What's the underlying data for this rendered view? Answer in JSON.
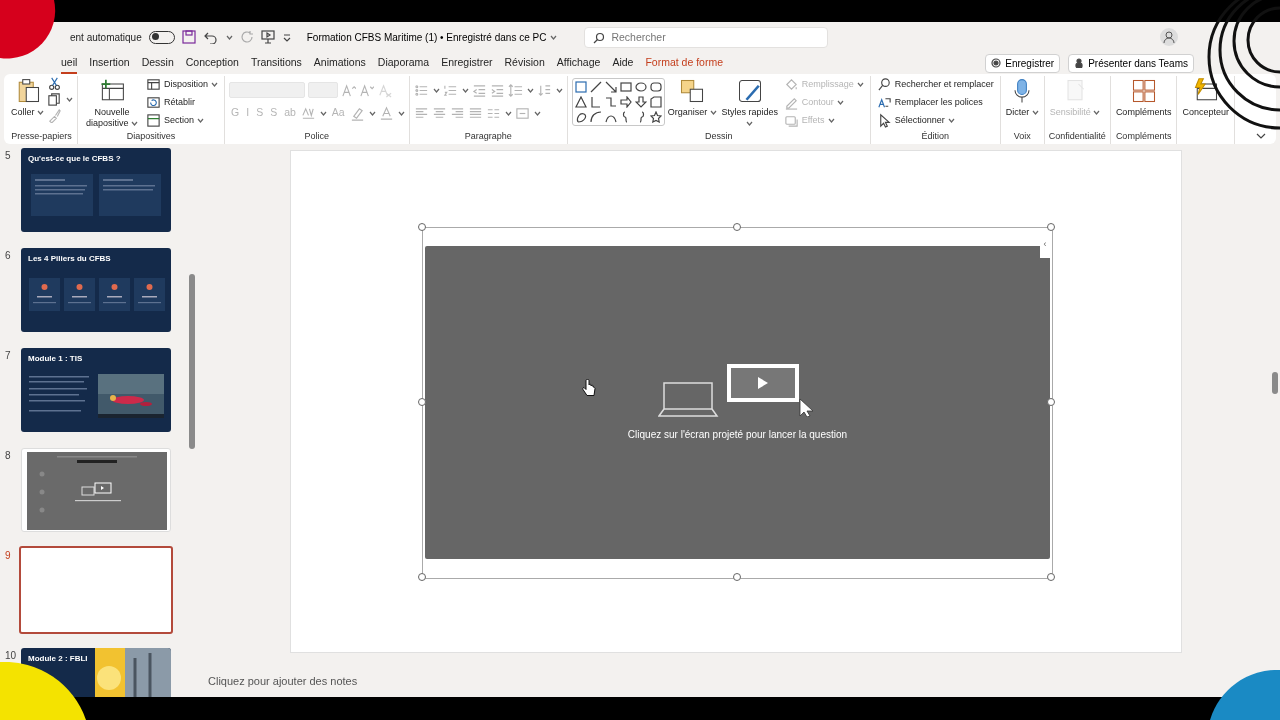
{
  "title_bar": {
    "autosave": {
      "label": "ent automatique",
      "on": false
    },
    "document_title": "Formation CFBS Maritime (1) • Enregistré dans ce PC",
    "search": {
      "placeholder": "Rechercher"
    }
  },
  "ribbon_tabs": [
    {
      "label": "ueil",
      "selected": true,
      "kind": "normal"
    },
    {
      "label": "Insertion",
      "selected": false,
      "kind": "normal"
    },
    {
      "label": "Dessin",
      "selected": false,
      "kind": "normal"
    },
    {
      "label": "Conception",
      "selected": false,
      "kind": "normal"
    },
    {
      "label": "Transitions",
      "selected": false,
      "kind": "normal"
    },
    {
      "label": "Animations",
      "selected": false,
      "kind": "normal"
    },
    {
      "label": "Diaporama",
      "selected": false,
      "kind": "normal"
    },
    {
      "label": "Enregistrer",
      "selected": false,
      "kind": "normal"
    },
    {
      "label": "Révision",
      "selected": false,
      "kind": "normal"
    },
    {
      "label": "Affichage",
      "selected": false,
      "kind": "normal"
    },
    {
      "label": "Aide",
      "selected": false,
      "kind": "normal"
    },
    {
      "label": "Format de forme",
      "selected": false,
      "kind": "contextual"
    }
  ],
  "ribbon_actions": [
    {
      "label": "Enregistrer"
    },
    {
      "label": "Présenter dans Teams"
    }
  ],
  "ribbon_groups": [
    {
      "label": "Presse-papiers",
      "columns": [
        [
          {
            "kind": "large",
            "label": "Coller",
            "dropdown": true,
            "disabled": false
          }
        ],
        [
          {
            "kind": "icon",
            "dropdown": false,
            "disabled": false
          },
          {
            "kind": "icon",
            "dropdown": true,
            "disabled": false
          },
          {
            "kind": "icon",
            "dropdown": false,
            "disabled": true
          }
        ]
      ]
    },
    {
      "label": "Diapositives",
      "columns": [
        [
          {
            "kind": "large",
            "label": "Nouvelle diapositive",
            "dropdown": true,
            "disabled": false
          }
        ],
        [
          {
            "kind": "small",
            "label": "Disposition",
            "dropdown": true,
            "disabled": false
          },
          {
            "kind": "small",
            "label": "Rétablir",
            "dropdown": false,
            "disabled": false
          },
          {
            "kind": "small",
            "label": "Section",
            "dropdown": true,
            "disabled": false
          }
        ]
      ]
    },
    {
      "label": "Police",
      "rows": [
        [
          {
            "kind": "field",
            "disabled": true
          },
          {
            "kind": "field",
            "disabled": true
          },
          {
            "kind": "icon",
            "dropdown": false,
            "disabled": true
          },
          {
            "kind": "icon",
            "dropdown": false,
            "disabled": true
          },
          {
            "kind": "icon",
            "dropdown": false,
            "disabled": true
          }
        ],
        [
          {
            "kind": "glyph",
            "label": "G",
            "disabled": true
          },
          {
            "kind": "glyph",
            "label": "I",
            "disabled": true
          },
          {
            "kind": "glyph",
            "label": "S",
            "disabled": true
          },
          {
            "kind": "glyph",
            "label": "S",
            "disabled": true
          },
          {
            "kind": "glyph",
            "label": "ab",
            "disabled": true
          },
          {
            "kind": "icon",
            "dropdown": true,
            "disabled": true
          },
          {
            "kind": "glyph",
            "label": "Aa",
            "disabled": true
          },
          {
            "kind": "icon",
            "dropdown": true,
            "disabled": true
          },
          {
            "kind": "icon",
            "dropdown": true,
            "disabled": true
          }
        ]
      ]
    },
    {
      "label": "Paragraphe",
      "rows": [
        [
          {
            "kind": "icon",
            "dropdown": true,
            "disabled": true
          },
          {
            "kind": "icon",
            "dropdown": true,
            "disabled": true
          },
          {
            "kind": "icon",
            "dropdown": false,
            "disabled": true
          },
          {
            "kind": "icon",
            "dropdown": false,
            "disabled": true
          },
          {
            "kind": "icon",
            "dropdown": true,
            "disabled": true
          },
          {
            "kind": "icon",
            "dropdown": true,
            "disabled": true
          }
        ],
        [
          {
            "kind": "icon",
            "dropdown": false,
            "disabled": true
          },
          {
            "kind": "icon",
            "dropdown": false,
            "disabled": true
          },
          {
            "kind": "icon",
            "dropdown": false,
            "disabled": true
          },
          {
            "kind": "icon",
            "dropdown": false,
            "disabled": true
          },
          {
            "kind": "icon",
            "dropdown": true,
            "disabled": true
          },
          {
            "kind": "icon",
            "dropdown": true,
            "disabled": true
          }
        ]
      ]
    },
    {
      "label": "Dessin",
      "columns": [
        [
          {
            "kind": "gallery"
          }
        ],
        [
          {
            "kind": "large",
            "label": "Organiser",
            "dropdown": true,
            "disabled": false
          }
        ],
        [
          {
            "kind": "large",
            "label": "Styles rapides",
            "dropdown": true,
            "disabled": false
          }
        ],
        [
          {
            "kind": "small",
            "label": "Remplissage",
            "dropdown": true,
            "disabled": true
          },
          {
            "kind": "small",
            "label": "Contour",
            "dropdown": true,
            "disabled": true
          },
          {
            "kind": "small",
            "label": "Effets",
            "dropdown": true,
            "disabled": true
          }
        ]
      ]
    },
    {
      "label": "Édition",
      "columns": [
        [
          {
            "kind": "small",
            "label": "Rechercher et remplacer",
            "dropdown": false,
            "disabled": false
          },
          {
            "kind": "small",
            "label": "Remplacer les polices",
            "dropdown": false,
            "disabled": false
          },
          {
            "kind": "small",
            "label": "Sélectionner",
            "dropdown": true,
            "disabled": false
          }
        ]
      ]
    },
    {
      "label": "Voix",
      "columns": [
        [
          {
            "kind": "large",
            "label": "Dicter",
            "dropdown": true,
            "disabled": false
          }
        ]
      ]
    },
    {
      "label": "Confidentialité",
      "columns": [
        [
          {
            "kind": "large",
            "label": "Sensibilité",
            "dropdown": true,
            "disabled": true
          }
        ]
      ]
    },
    {
      "label": "Compléments",
      "columns": [
        [
          {
            "kind": "large",
            "label": "Compléments",
            "dropdown": false,
            "disabled": false
          }
        ]
      ]
    },
    {
      "columns": [
        [
          {
            "kind": "large",
            "label": "Concepteur",
            "dropdown": false,
            "disabled": false
          }
        ]
      ]
    }
  ],
  "slides": [
    {
      "number": "5",
      "title": "Qu'est-ce que le CFBS ?",
      "kind": "two-cards",
      "selected": false
    },
    {
      "number": "6",
      "title": "Les 4 Piliers du CFBS",
      "kind": "four-cards",
      "selected": false
    },
    {
      "number": "7",
      "title": "Module 1 : TIS",
      "selected": false
    },
    {
      "number": "8",
      "kind": "quiz",
      "selected": false
    },
    {
      "number": "9",
      "kind": "blank",
      "selected": true
    },
    {
      "number": "10",
      "title": "Module 2 : FBLI",
      "kind": "photo-split",
      "selected": false
    }
  ],
  "current_slide": {
    "embed": {
      "selected": true,
      "tab": "‹",
      "caption": "Cliquez sur l'écran projeté pour lancer la question"
    }
  },
  "notes": {
    "placeholder": "Cliquez pour ajouter des notes"
  }
}
